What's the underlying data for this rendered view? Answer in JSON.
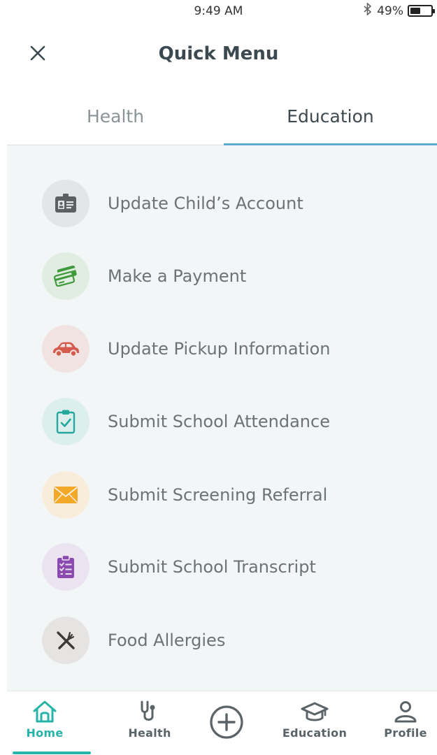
{
  "status_bar": {
    "time": "9:49 AM",
    "battery": "49%",
    "battery_level": 0.49
  },
  "header": {
    "title": "Quick Menu",
    "close_icon": "close-icon"
  },
  "tabs": [
    {
      "label": "Health",
      "active": false
    },
    {
      "label": "Education",
      "active": true
    }
  ],
  "colors": {
    "accent_tab": "#5fa8cf",
    "nav_active": "#26b3a8",
    "content_bg": "#f3f6f7"
  },
  "menu": [
    {
      "label": "Update Child’s Account",
      "icon": "id-card-icon",
      "color": "#5c6063",
      "bg": "#e3e5e6"
    },
    {
      "label": "Make a Payment",
      "icon": "payment-cards-icon",
      "color": "#3e9a3a",
      "bg": "#e1ede1"
    },
    {
      "label": "Update Pickup Information",
      "icon": "car-icon",
      "color": "#d45c4f",
      "bg": "#f1e3e1"
    },
    {
      "label": "Submit School Attendance",
      "icon": "clipboard-check-icon",
      "color": "#24a89e",
      "bg": "#dcefed"
    },
    {
      "label": "Submit Screening Referral",
      "icon": "envelope-icon",
      "color": "#f2a928",
      "bg": "#f8ecdb"
    },
    {
      "label": "Submit School Transcript",
      "icon": "clipboard-list-icon",
      "color": "#8a4ab0",
      "bg": "#ebe3ef"
    },
    {
      "label": "Food Allergies",
      "icon": "fork-knife-icon",
      "color": "#3e3a36",
      "bg": "#e6e4e2"
    }
  ],
  "bottom_nav": [
    {
      "label": "Home",
      "icon": "home-icon",
      "active": true
    },
    {
      "label": "Health",
      "icon": "stethoscope-icon",
      "active": false
    },
    {
      "label": "",
      "icon": "add-circle-icon",
      "active": false
    },
    {
      "label": "Education",
      "icon": "graduation-cap-icon",
      "active": false
    },
    {
      "label": "Profile",
      "icon": "person-icon",
      "active": false
    }
  ]
}
